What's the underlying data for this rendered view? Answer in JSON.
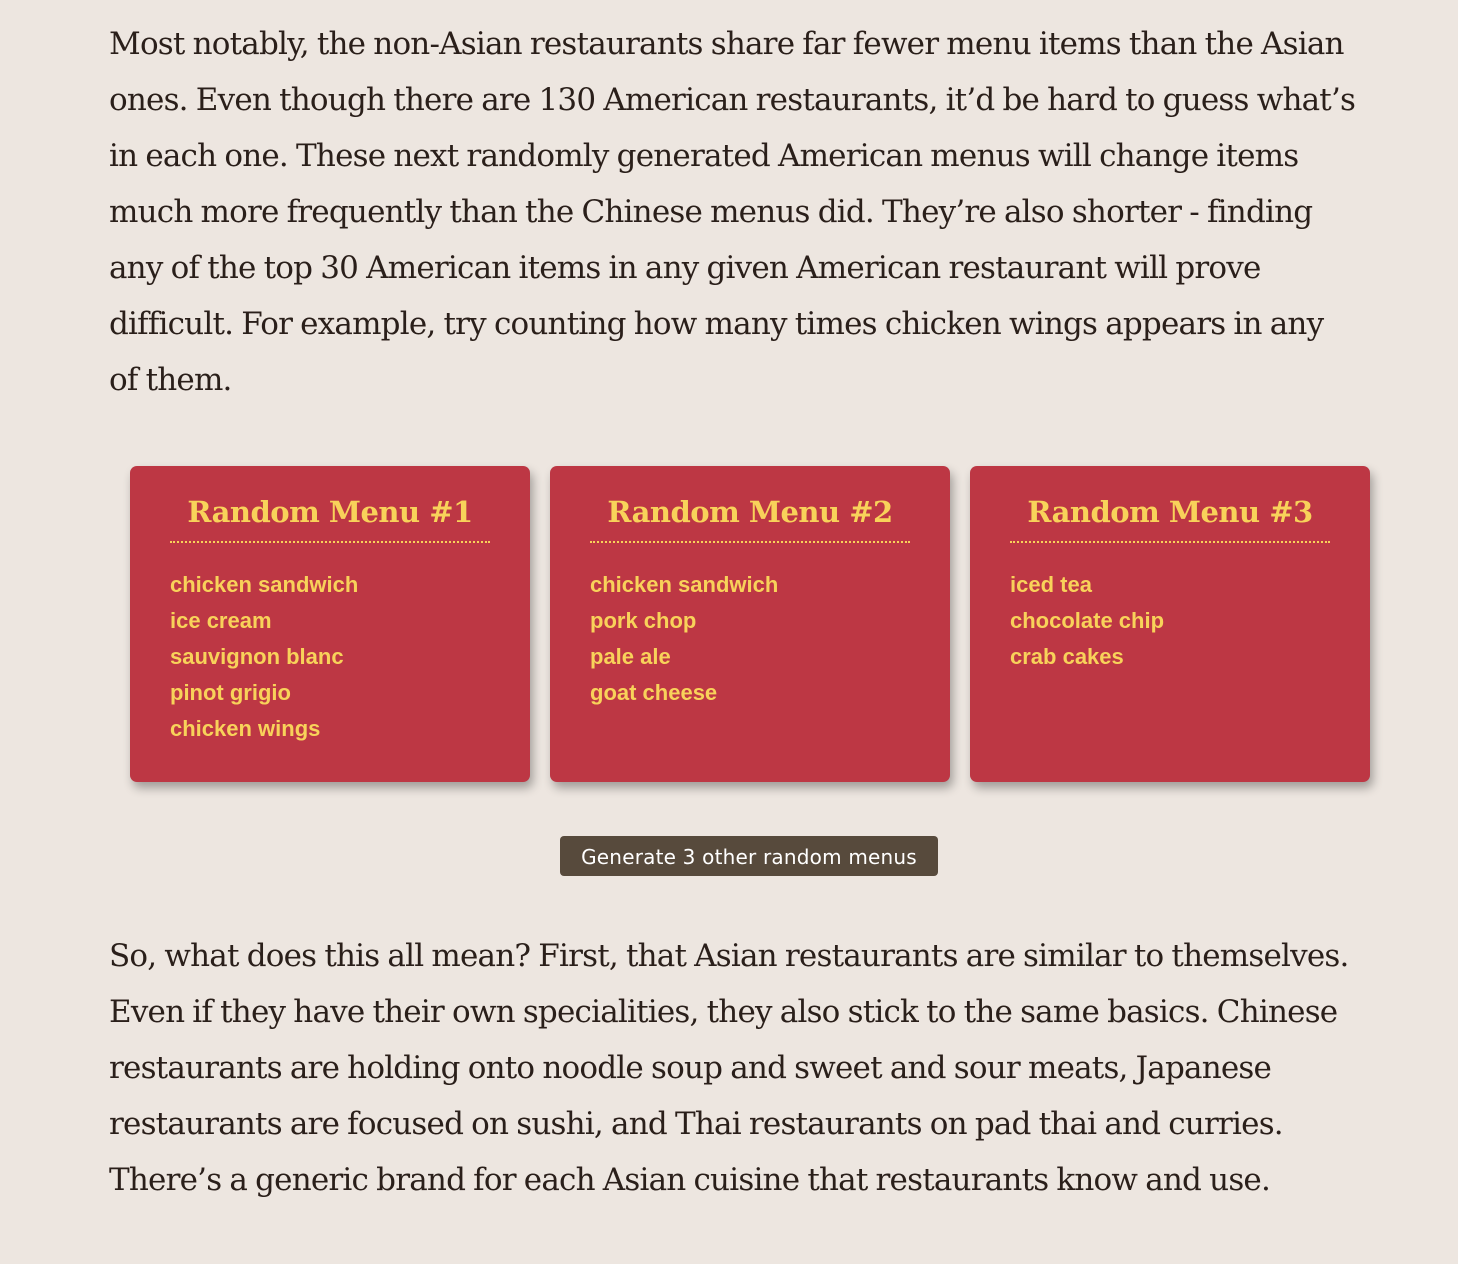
{
  "intro_paragraph": {
    "lines": [
      "Most notably, the non-Asian restaurants share far fewer menu items than the Asian",
      "ones. Even though there are 130 American restaurants, it’d be hard to guess what’s",
      "in each one. These next randomly generated American menus will change items",
      "much more frequently than the Chinese menus did. They’re also shorter - finding",
      "any of the top 30 American items in any given American restaurant will prove",
      "difficult. For example, try counting how many times chicken wings appears in any",
      "of them."
    ]
  },
  "menus": [
    {
      "title": "Random Menu #1",
      "items": [
        "chicken sandwich",
        "ice cream",
        "sauvignon blanc",
        "pinot grigio",
        "chicken wings"
      ]
    },
    {
      "title": "Random Menu #2",
      "items": [
        "chicken sandwich",
        "pork chop",
        "pale ale",
        "goat cheese"
      ]
    },
    {
      "title": "Random Menu #3",
      "items": [
        "iced tea",
        "chocolate chip",
        "crab cakes"
      ]
    }
  ],
  "generate_button": {
    "label": "Generate 3 other random menus"
  },
  "outro_paragraph": {
    "lines": [
      "So, what does this all mean? First, that Asian restaurants are similar to themselves.",
      "Even if they have their own specialities, they also stick to the same basics. Chinese",
      "restaurants are holding onto noodle soup and sweet and sour meats, Japanese",
      "restaurants are focused on sushi, and Thai restaurants on pad thai and curries.",
      "There’s a generic brand for each Asian cuisine that restaurants know and use."
    ]
  },
  "colors": {
    "page_background": "#ede6e0",
    "body_text": "#2a1f1a",
    "menu_card": "#bd3744",
    "menu_text": "#f8d25a",
    "button_background": "#574a3c",
    "button_text": "#ffffff"
  }
}
